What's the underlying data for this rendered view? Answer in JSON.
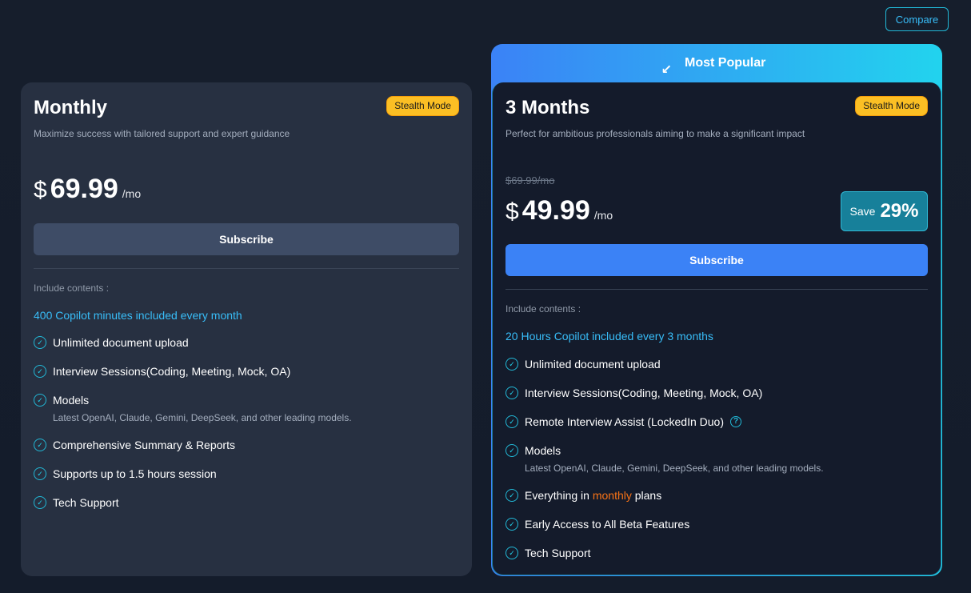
{
  "header": {
    "compare_label": "Compare"
  },
  "plans": [
    {
      "title": "Monthly",
      "badge": "Stealth Mode",
      "description": "Maximize success with tailored support and expert guidance",
      "currency": "$",
      "price": "69.99",
      "period": "/mo",
      "subscribe_label": "Subscribe",
      "include_label": "Include contents :",
      "highlight": "400 Copilot minutes included every month",
      "features": [
        {
          "text": "Unlimited document upload"
        },
        {
          "text": "Interview Sessions(Coding, Meeting, Mock, OA)"
        },
        {
          "text": "Models",
          "sub": "Latest OpenAI, Claude, Gemini, DeepSeek, and other leading models."
        },
        {
          "text": "Comprehensive Summary & Reports"
        },
        {
          "text": "Supports up to 1.5 hours session"
        },
        {
          "text": "Tech Support"
        }
      ]
    },
    {
      "ribbon": "Most Popular",
      "title": "3 Months",
      "badge": "Stealth Mode",
      "description": "Perfect for ambitious professionals aiming to make a significant impact",
      "old_price": "$69.99/mo",
      "currency": "$",
      "price": "49.99",
      "period": "/mo",
      "save_label": "Save",
      "save_pct": "29%",
      "subscribe_label": "Subscribe",
      "include_label": "Include contents :",
      "highlight": "20 Hours Copilot included every 3 months",
      "features": [
        {
          "text": "Unlimited document upload"
        },
        {
          "text": "Interview Sessions(Coding, Meeting, Mock, OA)"
        },
        {
          "text": "Remote Interview Assist (LockedIn Duo)"
        },
        {
          "text": "Models",
          "sub": "Latest OpenAI, Claude, Gemini, DeepSeek, and other leading models."
        },
        {
          "text_before": "Everything in ",
          "text_highlight": "monthly",
          "text_after": " plans"
        },
        {
          "text": "Early Access to All Beta Features"
        },
        {
          "text": "Tech Support"
        }
      ]
    }
  ],
  "colors": {
    "accent": "#38bdf8",
    "badge": "#fbbf24",
    "primary_button": "#3b82f6",
    "orange": "#f97316"
  }
}
